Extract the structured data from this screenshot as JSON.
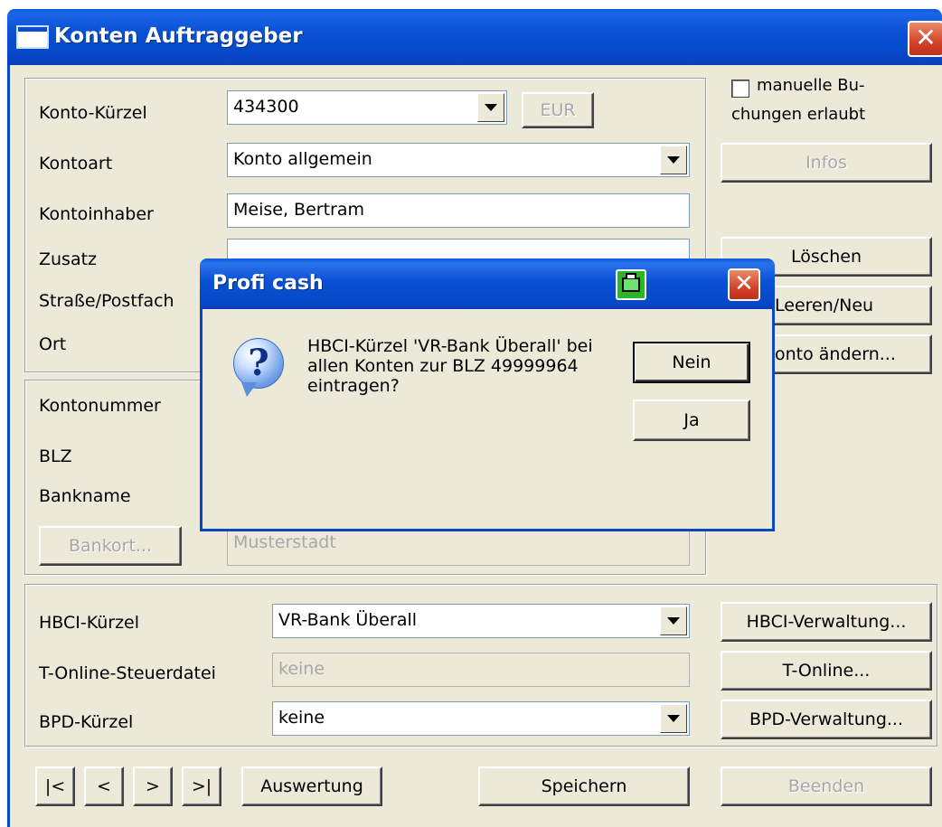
{
  "window": {
    "title": "Konten Auftraggeber",
    "close_glyph": "✕",
    "icon": "window-icon"
  },
  "account": {
    "kuerzel_label": "Konto-Kürzel",
    "kuerzel_value": "434300",
    "currency_button": "EUR",
    "kontoart_label": "Kontoart",
    "kontoart_value": "Konto allgemein",
    "inhaber_label": "Kontoinhaber",
    "inhaber_value": "Meise, Bertram",
    "zusatz_label": "Zusatz",
    "zusatz_value": "",
    "strasse_label": "Straße/Postfach",
    "ort_label": "Ort"
  },
  "sidebar": {
    "manual_booking_label_1": "manuelle Bu-",
    "manual_booking_label_2": "chungen erlaubt",
    "infos": "Infos",
    "loeschen": "Löschen",
    "leeren_neu": "Leeren/Neu",
    "konto_aendern": "onto ändern..."
  },
  "bank": {
    "kontonummer_label": "Kontonummer",
    "blz_label": "BLZ",
    "bankname_label": "Bankname",
    "bankort_button": "Bankort...",
    "bankort_value": "Musterstadt"
  },
  "hbci": {
    "hbci_label": "HBCI-Kürzel",
    "hbci_value": "VR-Bank Überall",
    "hbci_button": "HBCI-Verwaltung...",
    "tonline_label": "T-Online-Steuerdatei",
    "tonline_value": "keine",
    "tonline_button": "T-Online...",
    "bpd_label": "BPD-Kürzel",
    "bpd_value": "keine",
    "bpd_button": "BPD-Verwaltung..."
  },
  "footer": {
    "first": "|<",
    "prev": "<",
    "next": ">",
    "last": ">|",
    "auswertung": "Auswertung",
    "speichern": "Speichern",
    "beenden": "Beenden"
  },
  "dialog": {
    "title": "Profi cash",
    "message": "HBCI-Kürzel 'VR-Bank Überall' bei\nallen Konten zur BLZ 49999964\neintragen?",
    "no_button": "Nein",
    "yes_button": "Ja",
    "icon": "question-icon",
    "print_icon": "printer-icon"
  },
  "colors": {
    "titlebar": "#0a51d6",
    "face": "#ece9d8",
    "close": "#d3432a"
  }
}
